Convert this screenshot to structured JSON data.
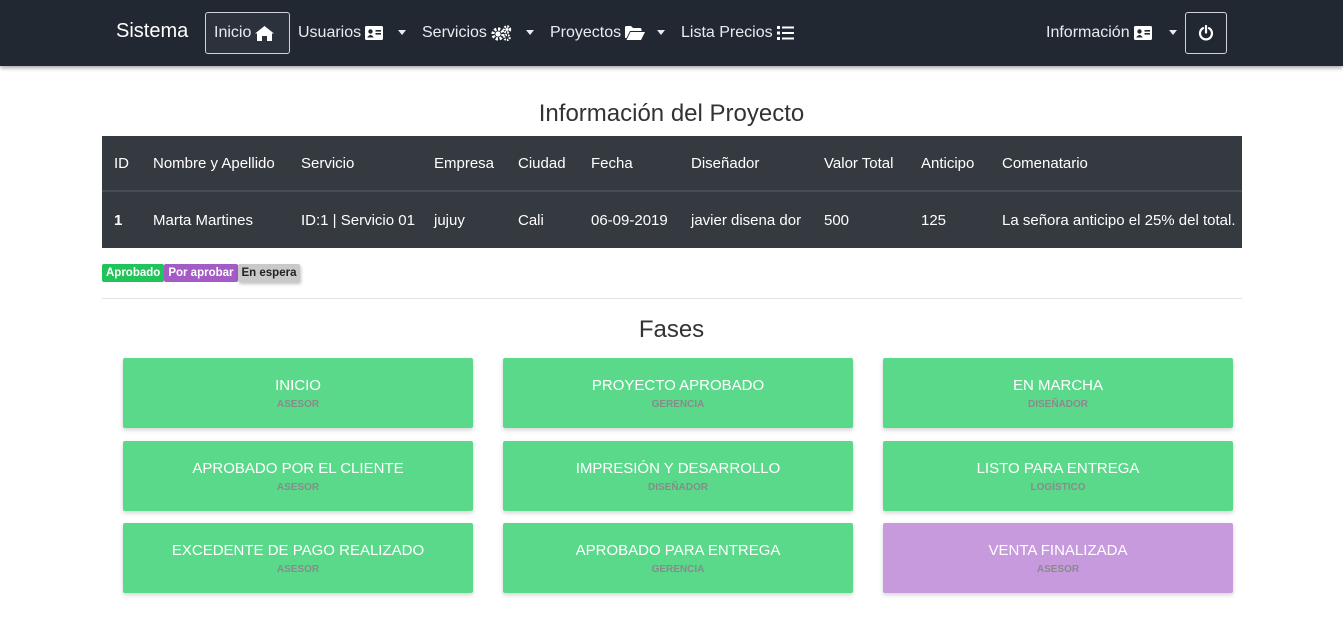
{
  "navbar": {
    "brand": "Sistema",
    "items": [
      {
        "label": "Inicio",
        "icon": "home-icon",
        "active": true
      },
      {
        "label": "Usuarios",
        "icon": "id-card-icon",
        "dropdown": true
      },
      {
        "label": "Servicios",
        "icon": "cogs-icon",
        "dropdown": true
      },
      {
        "label": "Proyectos",
        "icon": "folder-open-icon",
        "dropdown": true
      },
      {
        "label": "Lista Precios",
        "icon": "list-icon",
        "dropdown": false
      }
    ],
    "right": {
      "label": "Información",
      "icon": "id-card-icon",
      "dropdown": true
    },
    "power_icon": "power-icon"
  },
  "project": {
    "title": "Información del Proyecto",
    "headers": [
      "ID",
      "Nombre y Apellido",
      "Servicio",
      "Empresa",
      "Ciudad",
      "Fecha",
      "Diseñador",
      "Valor Total",
      "Anticipo",
      "Comenatario"
    ],
    "row": [
      "1",
      "Marta Martines",
      "ID:1 | Servicio 01",
      "jujuy",
      "Cali",
      "06-09-2019",
      "javier disena dor",
      "500",
      "125",
      "La señora anticipo el 25% del total."
    ]
  },
  "legend": {
    "approved": "Aprobado",
    "pending": "Por aprobar",
    "waiting": "En espera"
  },
  "phases_title": "Fases",
  "phases": [
    {
      "title": "INICIO",
      "role": "ASESOR",
      "status": "approved"
    },
    {
      "title": "PROYECTO APROBADO",
      "role": "GERENCIA",
      "status": "approved"
    },
    {
      "title": "EN MARCHA",
      "role": "DISEÑADOR",
      "status": "approved"
    },
    {
      "title": "APROBADO POR EL CLIENTE",
      "role": "ASESOR",
      "status": "approved"
    },
    {
      "title": "IMPRESIÓN Y DESARROLLO",
      "role": "DISEÑADOR",
      "status": "approved"
    },
    {
      "title": "LISTO PARA ENTREGA",
      "role": "LOGÍSTICO",
      "status": "approved"
    },
    {
      "title": "EXCEDENTE DE PAGO REALIZADO",
      "role": "ASESOR",
      "status": "approved"
    },
    {
      "title": "APROBADO PARA ENTREGA",
      "role": "GERENCIA",
      "status": "approved"
    },
    {
      "title": "VENTA FINALIZADA",
      "role": "ASESOR",
      "status": "pending"
    }
  ],
  "colors": {
    "navbar": "#222832",
    "approved": "#5bd98b",
    "pending": "#c79ade",
    "table": "#343a40"
  }
}
